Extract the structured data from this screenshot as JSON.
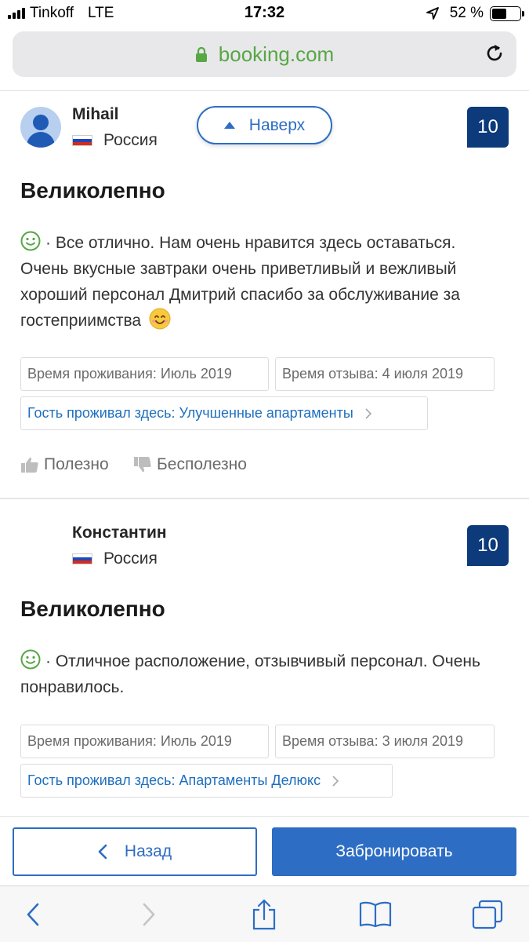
{
  "status_bar": {
    "carrier": "Tinkoff",
    "network": "LTE",
    "time": "17:32",
    "battery_percent": "52 %",
    "battery_level": 0.52
  },
  "browser": {
    "url": "booking.com",
    "url_color": "#57a744"
  },
  "scroll_to_top": {
    "label": "Наверх"
  },
  "reviews": [
    {
      "name": "Mihail",
      "country": "Россия",
      "score": "10",
      "title": "Великолепно",
      "text": "· Все отлично. Нам очень нравится здесь оставаться. Очень вкусные завтраки очень приветливый и вежливый хороший персонал Дмитрий спасибо за обслуживание за гостеприимства",
      "stay_period": "Время проживания: Июль 2019",
      "review_date": "Время отзыва: 4 июля 2019",
      "room": "Гость проживал здесь: Улучшенные апартаменты",
      "helpful_label": "Полезно",
      "not_helpful_label": "Бесполезно"
    },
    {
      "name": "Константин",
      "country": "Россия",
      "score": "10",
      "title": "Великолепно",
      "text": "· Отличное расположение, отзывчивый персонал. Очень понравилось.",
      "stay_period": "Время проживания: Июль 2019",
      "review_date": "Время отзыва: 3 июля 2019",
      "room": "Гость проживал здесь: Апартаменты Делюкс"
    }
  ],
  "booking_bar": {
    "back_label": "Назад",
    "book_label": "Забронировать"
  },
  "colors": {
    "accent": "#2d6dc4",
    "score_bg": "#0c3a7a",
    "positive": "#57a744"
  }
}
